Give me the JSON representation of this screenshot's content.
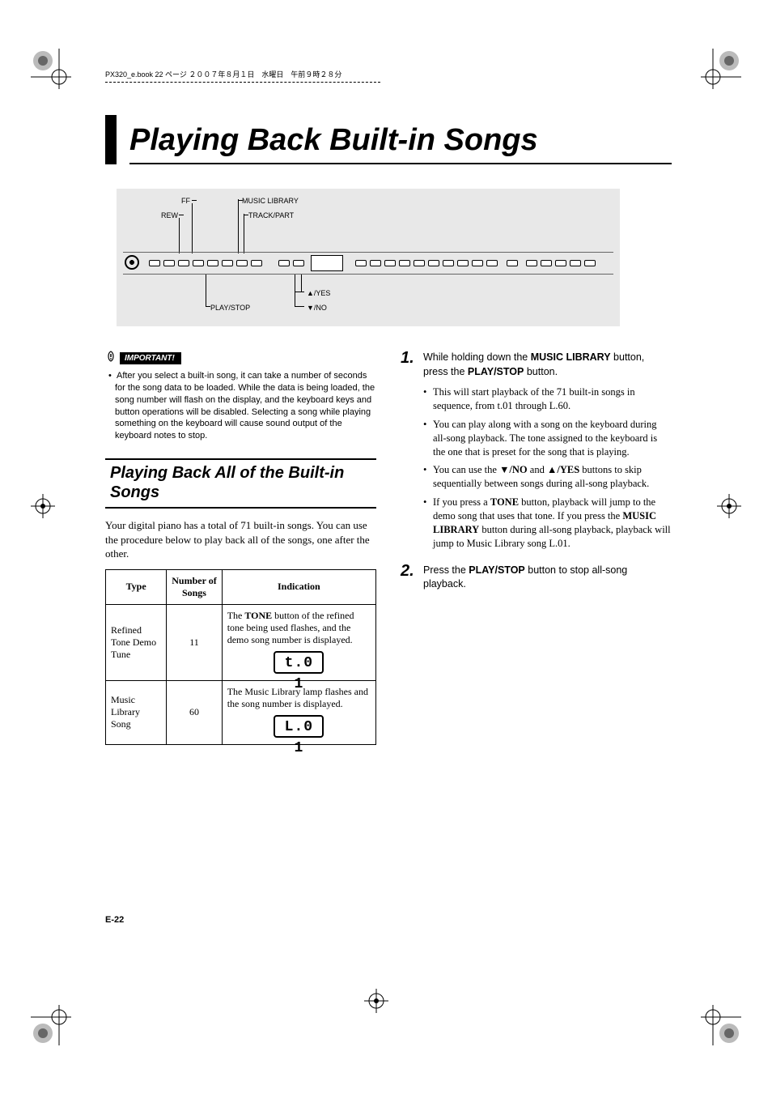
{
  "meta": {
    "crop_header": "PX320_e.book  22 ページ  ２００７年８月１日　水曜日　午前９時２８分"
  },
  "title": "Playing Back Built-in Songs",
  "diagram": {
    "labels": {
      "ff": "FF",
      "rew": "REW",
      "music_library": "MUSIC LIBRARY",
      "track_part": "TRACK/PART",
      "play_stop": "PLAY/STOP",
      "yes": "▲/YES",
      "no": "▼/NO"
    }
  },
  "important": {
    "tag": "IMPORTANT!",
    "bullet": "•",
    "text": "After you select a built-in song, it can take a number of seconds for the song data to be loaded. While the data is being loaded, the song number will flash on the display, and the keyboard keys and button operations will be disabled. Selecting a song while playing something on the keyboard will cause sound output of the keyboard notes to stop."
  },
  "section_heading": "Playing Back All of the Built-in Songs",
  "intro_para": "Your digital piano has a total of 71 built-in songs. You can use the procedure below to play back all of the songs, one after the other.",
  "table": {
    "headers": {
      "type": "Type",
      "count": "Number of Songs",
      "indication": "Indication"
    },
    "rows": [
      {
        "type": "Refined Tone Demo Tune",
        "count": "11",
        "indication_pre": "The ",
        "indication_bold": "TONE",
        "indication_post": " button of the refined tone being used flashes, and the demo song number is displayed.",
        "lcd": "t.0 1"
      },
      {
        "type": "Music Library Song",
        "count": "60",
        "indication_text": "The Music Library lamp flashes and the song number is displayed.",
        "lcd": "L.0 1"
      }
    ]
  },
  "steps": [
    {
      "head_pre": "While holding down the ",
      "head_b1": "MUSIC LIBRARY",
      "head_mid": " button, press the ",
      "head_b2": "PLAY/STOP",
      "head_post": " button.",
      "subs": {
        "s1": "This will start playback of the 71 built-in songs in sequence, from t.01 through L.60.",
        "s2": "You can play along with a song on the keyboard during all-song playback. The tone assigned to the keyboard is the one that is preset for the song that is playing.",
        "s3_pre": "You can use the ",
        "s3_b1": "▼/NO",
        "s3_mid": " and ",
        "s3_b2": "▲/YES",
        "s3_post": " buttons to skip sequentially between songs during all-song playback.",
        "s4_pre": "If you press a ",
        "s4_b1": "TONE",
        "s4_mid": " button, playback will jump to the demo song that uses that tone. If you press the ",
        "s4_b2": "MUSIC LIBRARY",
        "s4_post": " button during all-song playback, playback will jump to Music Library song L.01."
      }
    },
    {
      "head_pre": "Press the ",
      "head_b1": "PLAY/STOP",
      "head_post": " button to stop all-song playback."
    }
  ],
  "footer": {
    "page": "E-22"
  }
}
